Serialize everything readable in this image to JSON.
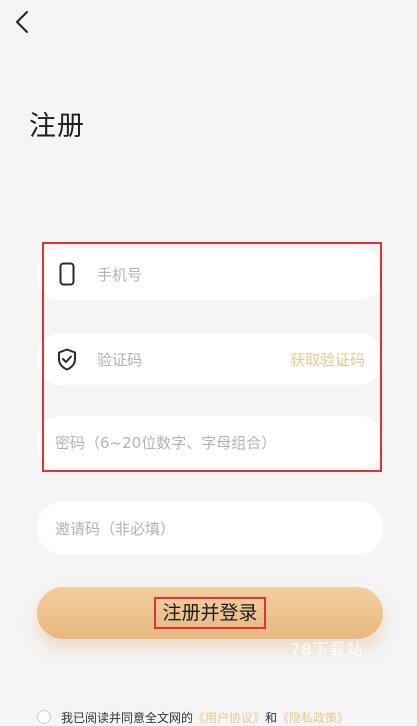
{
  "header": {
    "back_icon": "chevron-left-icon",
    "title": "注册"
  },
  "form": {
    "phone": {
      "icon": "phone-icon",
      "placeholder": "手机号"
    },
    "verification": {
      "icon": "shield-check-icon",
      "placeholder": "验证码",
      "get_code_label": "获取验证码"
    },
    "password": {
      "placeholder": "密码（6~20位数字、字母组合）"
    },
    "invite": {
      "placeholder": "邀请码（非必填）"
    }
  },
  "submit": {
    "label": "注册并登录"
  },
  "watermark": {
    "text": "78下载站"
  },
  "agreement": {
    "prefix": "我已阅读并同意全文网的",
    "user_agreement": "《用户协议》",
    "and": "和",
    "privacy_policy": "《隐私政策》"
  },
  "colors": {
    "background": "#f5f5f5",
    "accent_gold": "#ecc891",
    "button_gradient_top": "#f2cfa1",
    "button_gradient_bottom": "#e8b77e",
    "highlight_red": "#e3313a"
  }
}
